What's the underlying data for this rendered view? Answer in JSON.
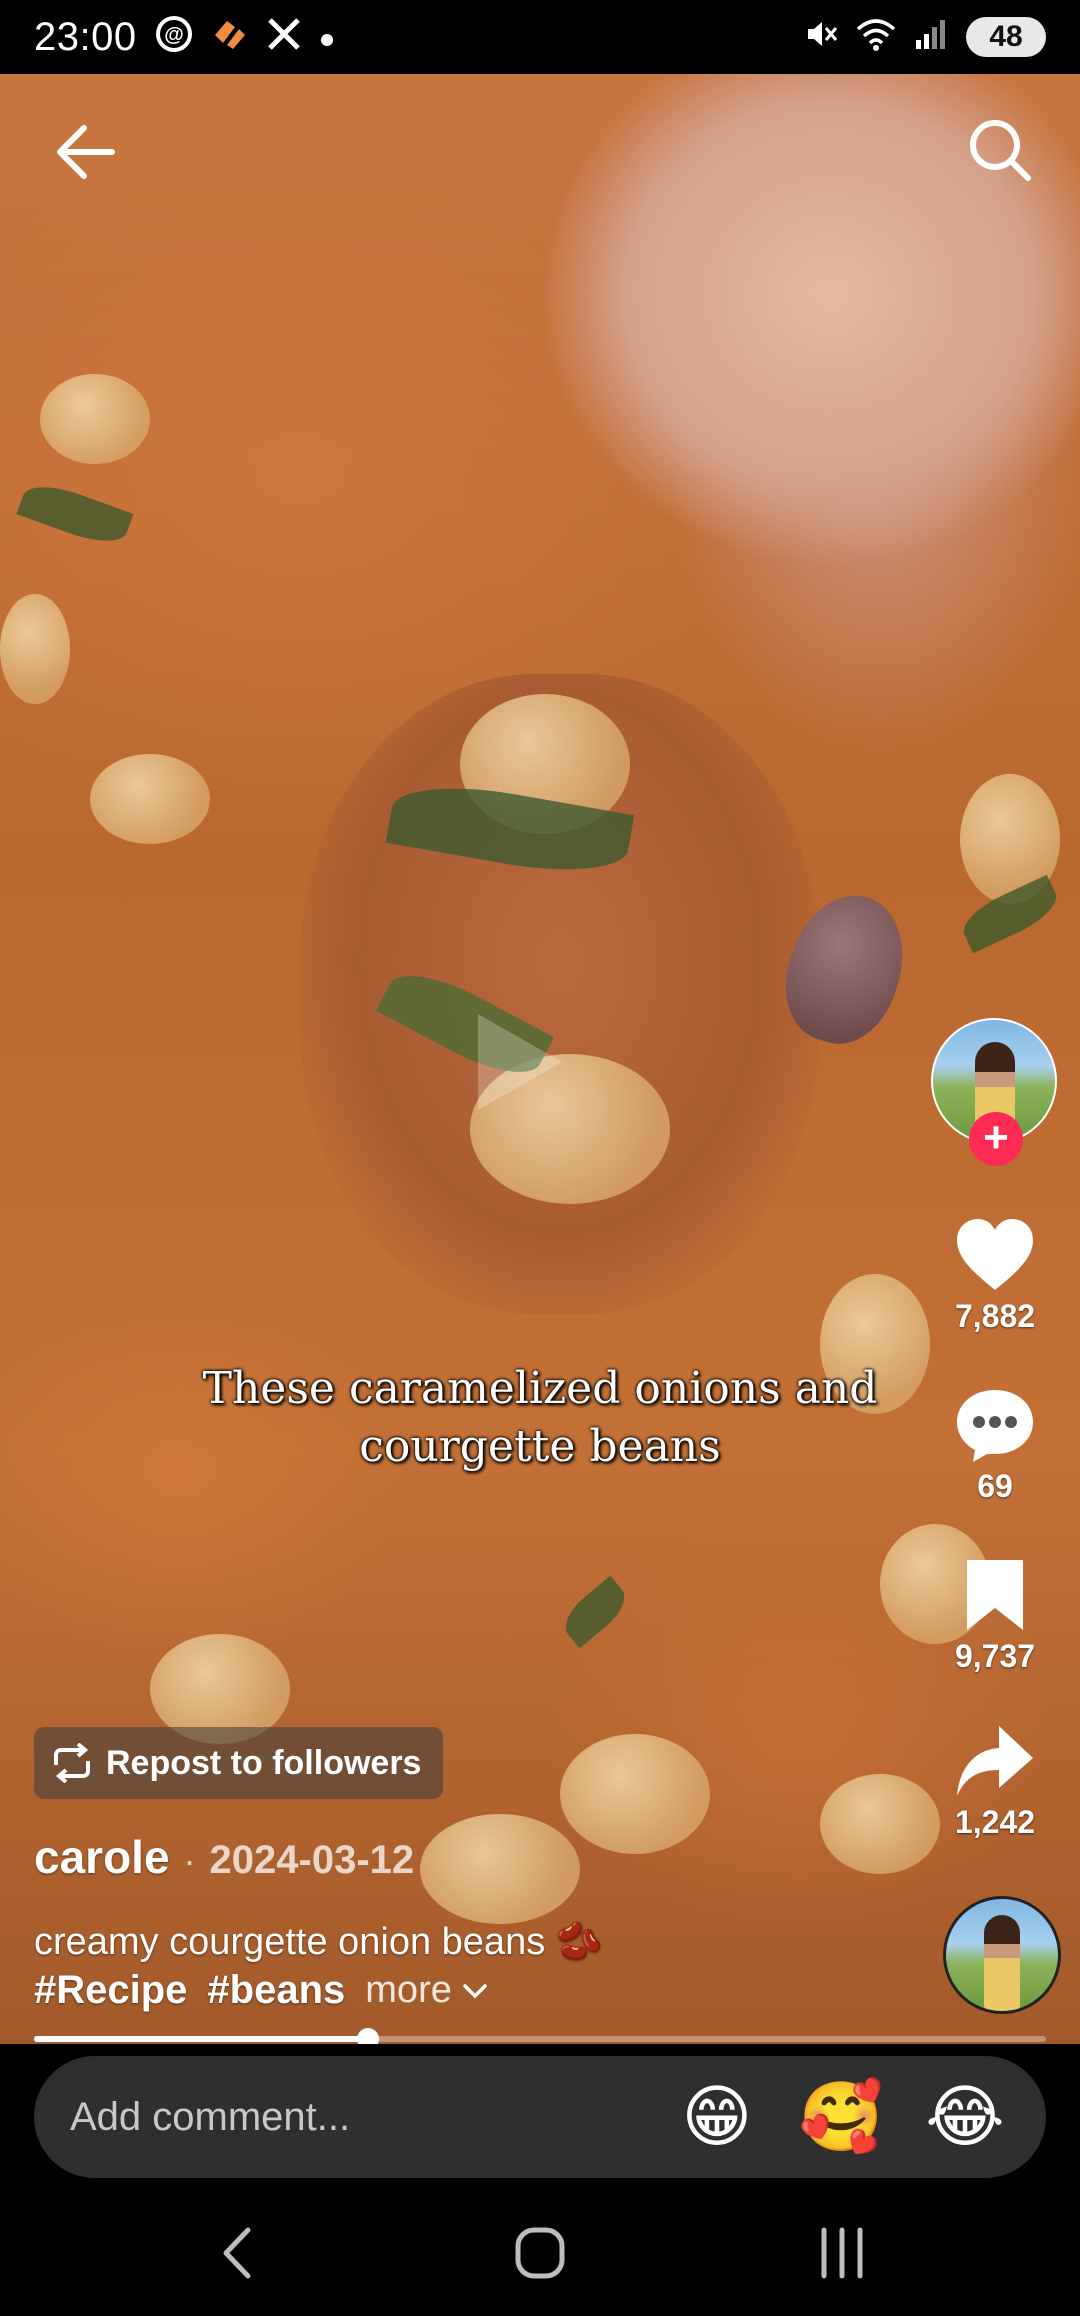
{
  "status_bar": {
    "time": "23:00",
    "left_icons": [
      "threads-icon",
      "app-icon",
      "x-icon",
      "dot-icon"
    ],
    "right_icons": [
      "mute-icon",
      "wifi-icon",
      "signal-icon"
    ],
    "battery": "48"
  },
  "video": {
    "overlay_caption_line1": "These caramelized onions and",
    "overlay_caption_line2": "courgette beans"
  },
  "actions": {
    "likes": "7,882",
    "comments": "69",
    "saves": "9,737",
    "shares": "1,242"
  },
  "repost": {
    "label": "Repost to followers"
  },
  "post": {
    "username": "carole",
    "separator": "·",
    "date": "2024-03-12",
    "description": "creamy courgette onion beans 🫘",
    "hashtags": [
      "#Recipe",
      "#beans"
    ],
    "more_label": "more"
  },
  "progress": {
    "fraction": 0.33
  },
  "comment": {
    "placeholder": "Add comment...",
    "emojis": [
      "😁",
      "🥰",
      "😂"
    ]
  },
  "colors": {
    "accent": "#fe2c55",
    "comment_bg": "#2f2f2f"
  }
}
